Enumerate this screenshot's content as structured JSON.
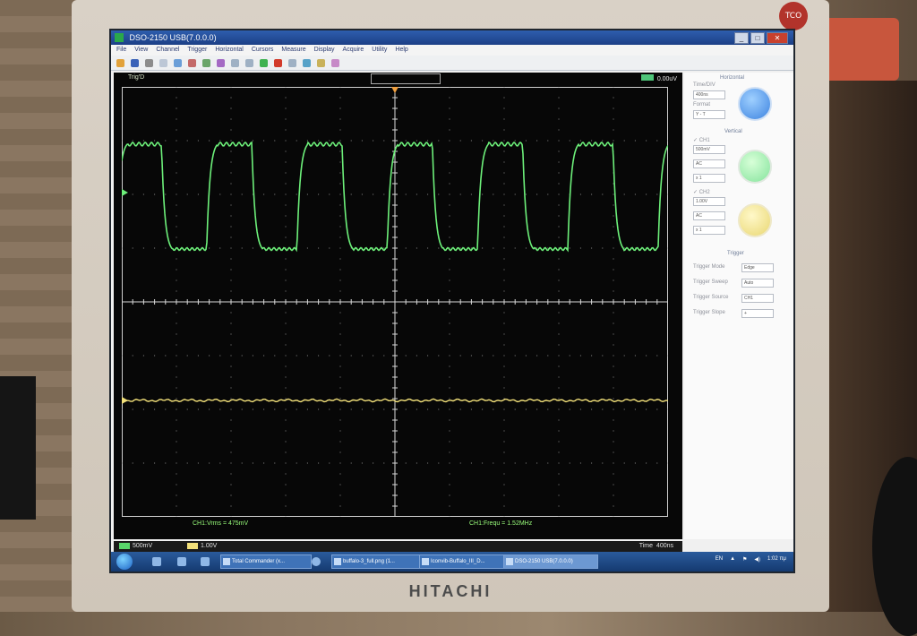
{
  "window": {
    "title": "DSO-2150 USB(7.0.0.0)",
    "controls": [
      "_",
      "□",
      "✕"
    ]
  },
  "menu": [
    "File",
    "View",
    "Channel",
    "Trigger",
    "Horizontal",
    "Cursors",
    "Measure",
    "Display",
    "Acquire",
    "Utility",
    "Help"
  ],
  "scope": {
    "trig_status": "Trig'D",
    "trig_level": "0.00uV",
    "measure_vrms": "CH1:Vrms = 475mV",
    "measure_freq": "CH1:Frequ = 1.52MHz",
    "ch1_scale": "500mV",
    "ch2_scale": "1.00V",
    "time_label": "Time",
    "time_value": "400ns"
  },
  "waveform": {
    "ch1_color": "#6df07a",
    "ch2_color": "#f2e07a",
    "periods_visible": 6,
    "ch1_high_div": 0.9,
    "ch1_low_div": -1.05
  },
  "panel": {
    "horizontal_title": "Horizontal",
    "time_div_label": "Time/DIV",
    "time_div_value": "400ns",
    "format_label": "Format",
    "format_value": "Y - T",
    "vertical_title": "Vertical",
    "ch1_label": "CH1",
    "ch1_volt": "500mV",
    "ch1_coupling": "AC",
    "ch1_probe": "x 1",
    "ch2_label": "CH2",
    "ch2_volt": "1.00V",
    "ch2_coupling": "AC",
    "ch2_probe": "x 1",
    "trigger_title": "Trigger",
    "trigger_mode_label": "Trigger Mode",
    "trigger_mode_value": "Edge",
    "trigger_sweep_label": "Trigger Sweep",
    "trigger_sweep_value": "Auto",
    "trigger_source_label": "Trigger Source",
    "trigger_source_value": "CH1",
    "trigger_slope_label": "Trigger Slope",
    "trigger_slope_value": "+"
  },
  "taskbar": {
    "tasks": [
      "Total Commander (x...",
      "buffalo-3_full.png (1...",
      "Iconvib-Buffalo_III_D...",
      "DSO-2150 USB(7.0.0.0)"
    ],
    "lang": "EN",
    "clock": "1:02 πμ"
  },
  "monitor": {
    "brand": "HITACHI"
  }
}
